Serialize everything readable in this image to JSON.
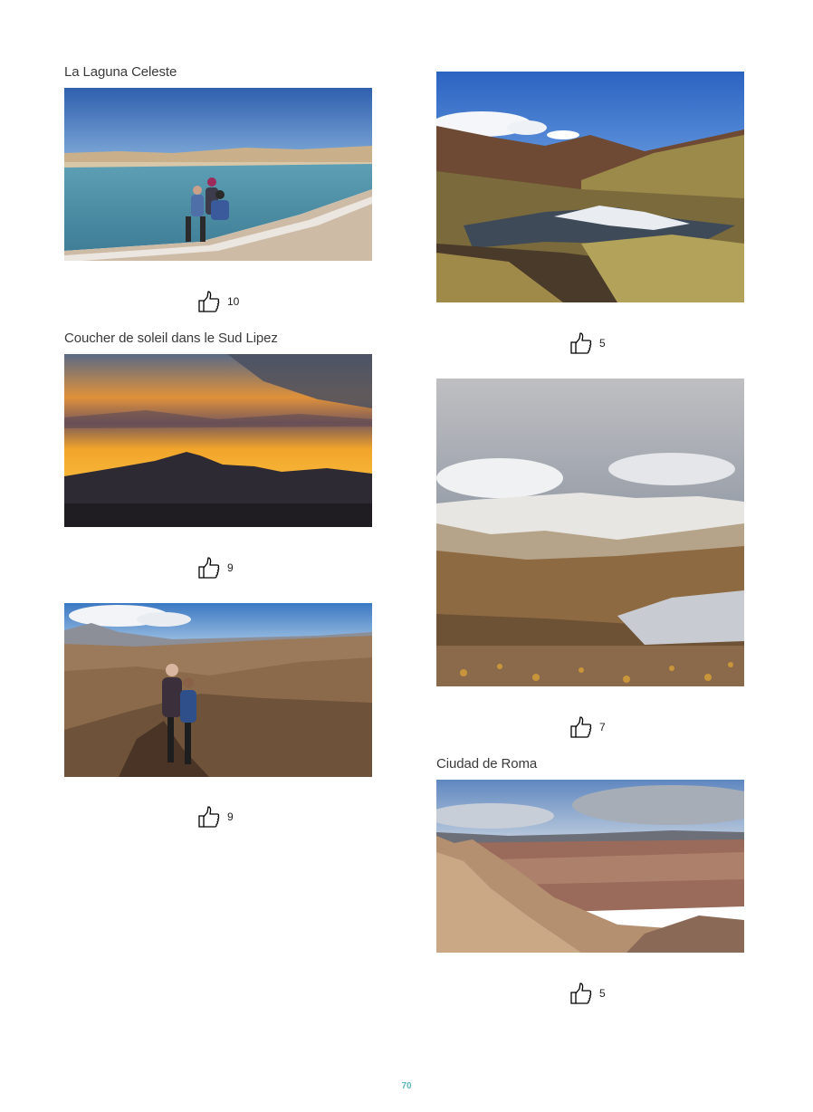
{
  "posts": [
    {
      "title": "La Laguna Celeste",
      "likes": "10"
    },
    {
      "title": "Coucher de soleil dans le Sud Lipez",
      "likes": "9"
    },
    {
      "title": "",
      "likes": "9"
    },
    {
      "title": "",
      "likes": "5"
    },
    {
      "title": "",
      "likes": "7"
    },
    {
      "title": "Ciudad de Roma",
      "likes": "5"
    }
  ],
  "icons": {
    "like": "thumbs-up-icon"
  },
  "colors": {
    "page_number": "#5fb8bd",
    "text": "#3a3a3a"
  },
  "footer": {
    "page_number": "70"
  }
}
